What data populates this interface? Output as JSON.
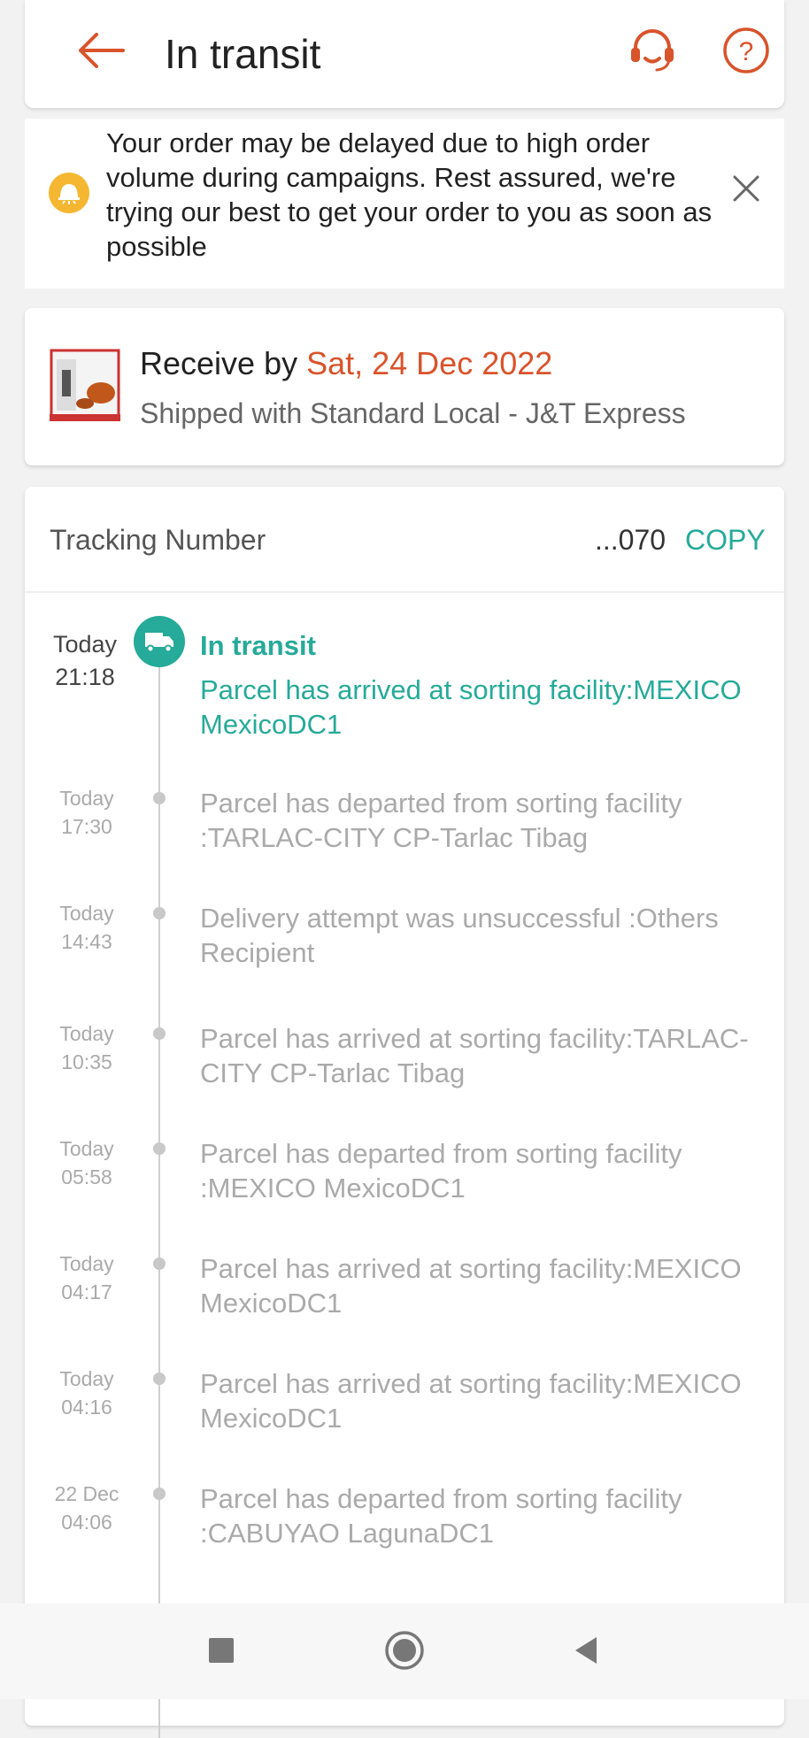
{
  "header": {
    "title": "In transit",
    "icons": [
      "back-arrow-icon",
      "customer-support-icon",
      "help-icon"
    ],
    "accent": "#d9532b"
  },
  "notice": {
    "text": "Your order may be delayed due to high order volume during campaigns. Rest assured, we're trying our best to get your order to you as soon as possible",
    "icon": "bell-icon",
    "close_icon": "close-icon",
    "icon_color": "#f5b731"
  },
  "receive": {
    "prefix": "Receive by ",
    "date": "Sat, 24 Dec 2022",
    "shipping": "Shipped with Standard Local - J&T Express"
  },
  "tracking": {
    "label": "Tracking Number",
    "number": "...070",
    "copy_label": "COPY",
    "accent": "#26aa99"
  },
  "events": [
    {
      "day": "Today",
      "time": "21:18",
      "status": "In transit",
      "text": "Parcel has arrived at sorting facility:MEXICO MexicoDC1"
    },
    {
      "day": "Today",
      "time": "17:30",
      "text": "Parcel has departed from sorting facility :TARLAC-CITY CP-Tarlac Tibag"
    },
    {
      "day": "Today",
      "time": "14:43",
      "text": "Delivery attempt was unsuccessful :Others Recipient"
    },
    {
      "day": "Today",
      "time": "10:35",
      "text": "Parcel has arrived at sorting facility:TARLAC-CITY CP-Tarlac Tibag"
    },
    {
      "day": "Today",
      "time": "05:58",
      "text": "Parcel has departed from sorting facility :MEXICO MexicoDC1"
    },
    {
      "day": "Today",
      "time": "04:17",
      "text": "Parcel has arrived at sorting facility:MEXICO MexicoDC1"
    },
    {
      "day": "Today",
      "time": "04:16",
      "text": "Parcel has arrived at sorting facility:MEXICO MexicoDC1"
    },
    {
      "day": "22 Dec",
      "time": "04:06",
      "text": "Parcel has departed from sorting facility :CABUYAO LagunaDC1"
    }
  ],
  "navbar": {
    "icons": [
      "recent-apps-icon",
      "home-icon",
      "back-icon"
    ]
  }
}
